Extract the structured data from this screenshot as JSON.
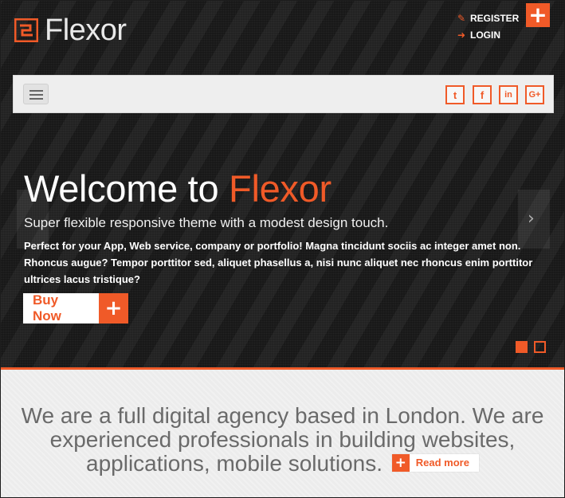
{
  "brand": {
    "name": "Flexor"
  },
  "header": {
    "register_label": "REGISTER",
    "login_label": "LOGIN",
    "corner_plus": "+"
  },
  "navbar": {
    "menu_icon": "hamburger-icon",
    "social": [
      {
        "name": "twitter-icon",
        "glyph": "t"
      },
      {
        "name": "facebook-icon",
        "glyph": "f"
      },
      {
        "name": "linkedin-icon",
        "glyph": "in"
      },
      {
        "name": "google-plus-icon",
        "glyph": "G+"
      }
    ]
  },
  "hero": {
    "title_prefix": "Welcome to ",
    "title_accent": "Flexor",
    "subtitle": "Super flexible responsive theme with a modest design touch.",
    "body": "Perfect for your App, Web service, company or portfolio! Magna tincidunt sociis ac integer amet non. Rhoncus augue? Tempor porttitor sed, aliquet phasellus a, nisi nunc aliquet nec rhoncus enim porttitor ultrices lacus tristique?",
    "cta_label": "Buy Now",
    "cta_plus": "+",
    "next_arrow": "›",
    "slides": {
      "count": 2,
      "active": 1
    }
  },
  "intro": {
    "text": "We are a full digital agency based in London. We are experienced professionals in building websites, applications, mobile solutions.",
    "readmore_label": "Read more",
    "readmore_plus": "+"
  },
  "colors": {
    "accent": "#f05a28",
    "hero_bg": "#181818",
    "intro_bg": "#ececec"
  }
}
